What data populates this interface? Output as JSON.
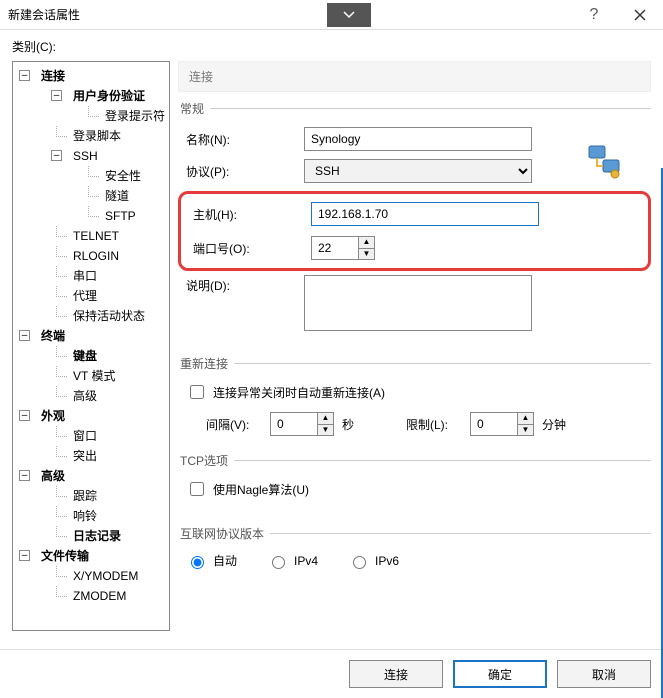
{
  "window": {
    "title": "新建会话属性"
  },
  "category_label": "类别(C):",
  "tree": {
    "connection": "连接",
    "auth": "用户身份验证",
    "login_prompt": "登录提示符",
    "login_script": "登录脚本",
    "ssh": "SSH",
    "security": "安全性",
    "tunnel": "隧道",
    "sftp": "SFTP",
    "telnet": "TELNET",
    "rlogin": "RLOGIN",
    "serial": "串口",
    "proxy": "代理",
    "keepalive": "保持活动状态",
    "terminal": "终端",
    "keyboard": "键盘",
    "vtmode": "VT 模式",
    "advanced_t": "高级",
    "appearance": "外观",
    "window": "窗口",
    "highlight": "突出",
    "advanced": "高级",
    "trace": "跟踪",
    "bell": "响铃",
    "logging": "日志记录",
    "filetransfer": "文件传输",
    "xymodem": "X/YMODEM",
    "zmodem": "ZMODEM"
  },
  "pane_header": "连接",
  "general": {
    "legend": "常规",
    "name_label": "名称(N):",
    "name_value": "Synology",
    "protocol_label": "协议(P):",
    "protocol_value": "SSH",
    "host_label": "主机(H):",
    "host_value": "192.168.1.70",
    "port_label": "端口号(O):",
    "port_value": "22",
    "desc_label": "说明(D):",
    "desc_value": ""
  },
  "reconnect": {
    "legend": "重新连接",
    "check_label": "连接异常关闭时自动重新连接(A)",
    "interval_label": "间隔(V):",
    "interval_value": "0",
    "sec": "秒",
    "limit_label": "限制(L):",
    "limit_value": "0",
    "min": "分钟"
  },
  "tcp": {
    "legend": "TCP选项",
    "nagle_label": "使用Nagle算法(U)"
  },
  "ipver": {
    "legend": "互联网协议版本",
    "auto": "自动",
    "ipv4": "IPv4",
    "ipv6": "IPv6"
  },
  "buttons": {
    "connect": "连接",
    "ok": "确定",
    "cancel": "取消"
  }
}
